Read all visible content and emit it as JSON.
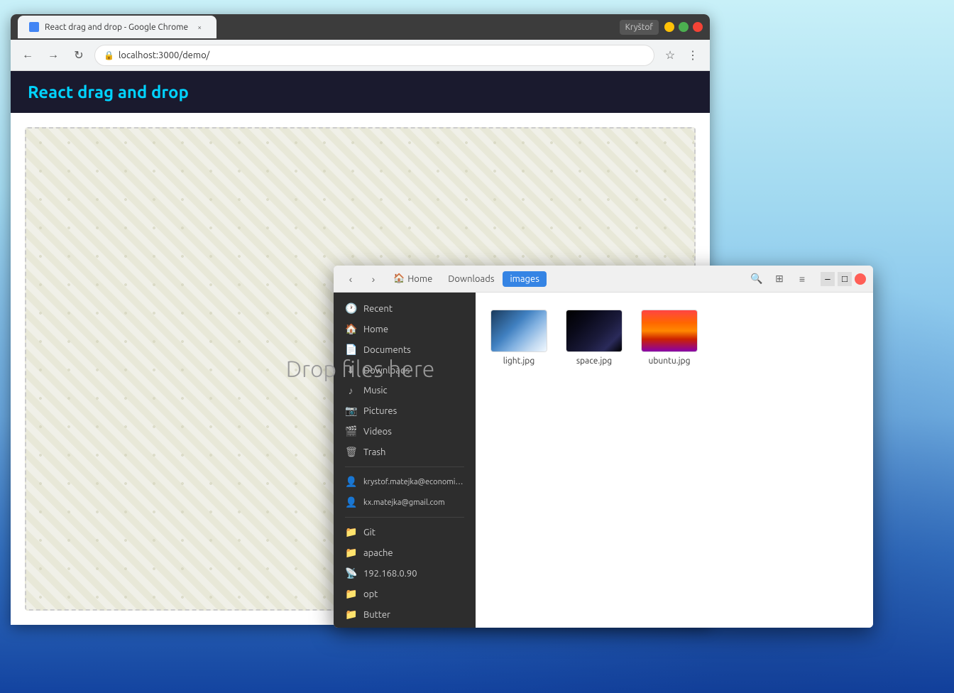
{
  "desktop": {
    "background": "teal-blue gradient"
  },
  "chrome": {
    "titlebar": {
      "title": "React drag and drop - Google Chrome",
      "profile": "Kryštof"
    },
    "tab": {
      "label": "React drag and drop - Google Chrome",
      "favicon": "chrome-icon"
    },
    "toolbar": {
      "back_label": "←",
      "forward_label": "→",
      "refresh_label": "↻",
      "address": "localhost:3000/demo/",
      "bookmark_label": "☆",
      "menu_label": "⋮"
    },
    "page": {
      "header_title": "React drag and drop",
      "drop_zone_text": "Drop files here"
    }
  },
  "file_manager": {
    "breadcrumb": {
      "home_label": "Home",
      "downloads_label": "Downloads",
      "images_label": "images"
    },
    "toolbar": {
      "back_label": "‹",
      "forward_label": "›",
      "search_label": "🔍",
      "grid_label": "⊞",
      "list_label": "≡",
      "min_label": "–",
      "max_label": "□",
      "close_label": "×"
    },
    "sidebar": {
      "items": [
        {
          "id": "recent",
          "label": "Recent",
          "icon": "🕐"
        },
        {
          "id": "home",
          "label": "Home",
          "icon": "🏠"
        },
        {
          "id": "documents",
          "label": "Documents",
          "icon": "📄"
        },
        {
          "id": "downloads",
          "label": "Downloads",
          "icon": "⬇"
        },
        {
          "id": "music",
          "label": "Music",
          "icon": "♪"
        },
        {
          "id": "pictures",
          "label": "Pictures",
          "icon": "📷"
        },
        {
          "id": "videos",
          "label": "Videos",
          "icon": "🎬"
        },
        {
          "id": "trash",
          "label": "Trash",
          "icon": "🗑"
        },
        {
          "id": "account1",
          "label": "krystof.matejka@economia.cz",
          "icon": "👤"
        },
        {
          "id": "account2",
          "label": "kx.matejka@gmail.com",
          "icon": "👤"
        },
        {
          "id": "git",
          "label": "Git",
          "icon": "📁"
        },
        {
          "id": "apache",
          "label": "apache",
          "icon": "📁"
        },
        {
          "id": "network",
          "label": "192.168.0.90",
          "icon": "📡"
        },
        {
          "id": "opt",
          "label": "opt",
          "icon": "📁"
        },
        {
          "id": "butter",
          "label": "Butter",
          "icon": "📁"
        }
      ]
    },
    "files": [
      {
        "id": "light",
        "name": "light.jpg",
        "thumb": "light"
      },
      {
        "id": "space",
        "name": "space.jpg",
        "thumb": "space"
      },
      {
        "id": "ubuntu",
        "name": "ubuntu.jpg",
        "thumb": "ubuntu"
      }
    ]
  }
}
